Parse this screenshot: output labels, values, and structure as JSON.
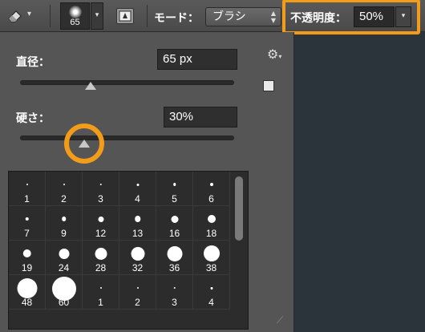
{
  "optionbar": {
    "brush_size": "65",
    "mode_label": "モード：",
    "mode_value": "ブラシ",
    "opacity_label": "不透明度：",
    "opacity_value": "50%",
    "dropdown_caret": "▾",
    "select_arrows": "▲\n▼"
  },
  "panel": {
    "diameter_label": "直径：",
    "diameter_value": "65 px",
    "diameter_fraction": 0.33,
    "hardness_label": "硬さ：",
    "hardness_value": "30%",
    "hardness_fraction": 0.3,
    "gear_icon": "⚙",
    "resize_icon": "⟋"
  },
  "presets": [
    {
      "label": "1",
      "size": 1
    },
    {
      "label": "2",
      "size": 2
    },
    {
      "label": "3",
      "size": 3
    },
    {
      "label": "4",
      "size": 4
    },
    {
      "label": "5",
      "size": 5
    },
    {
      "label": "6",
      "size": 6
    },
    {
      "label": "7",
      "size": 7
    },
    {
      "label": "9",
      "size": 9
    },
    {
      "label": "12",
      "size": 12
    },
    {
      "label": "13",
      "size": 13
    },
    {
      "label": "16",
      "size": 16
    },
    {
      "label": "18",
      "size": 18
    },
    {
      "label": "19",
      "size": 19
    },
    {
      "label": "24",
      "size": 24
    },
    {
      "label": "28",
      "size": 28
    },
    {
      "label": "32",
      "size": 32
    },
    {
      "label": "36",
      "size": 36
    },
    {
      "label": "38",
      "size": 38
    },
    {
      "label": "48",
      "size": 48
    },
    {
      "label": "60",
      "size": 60
    },
    {
      "label": "1",
      "size": 1
    },
    {
      "label": "2",
      "size": 2
    },
    {
      "label": "3",
      "size": 3
    },
    {
      "label": "4",
      "size": 4
    }
  ],
  "colors": {
    "highlight": "#f39c1a",
    "panel": "#555555",
    "grid": "#2c2c2c"
  }
}
